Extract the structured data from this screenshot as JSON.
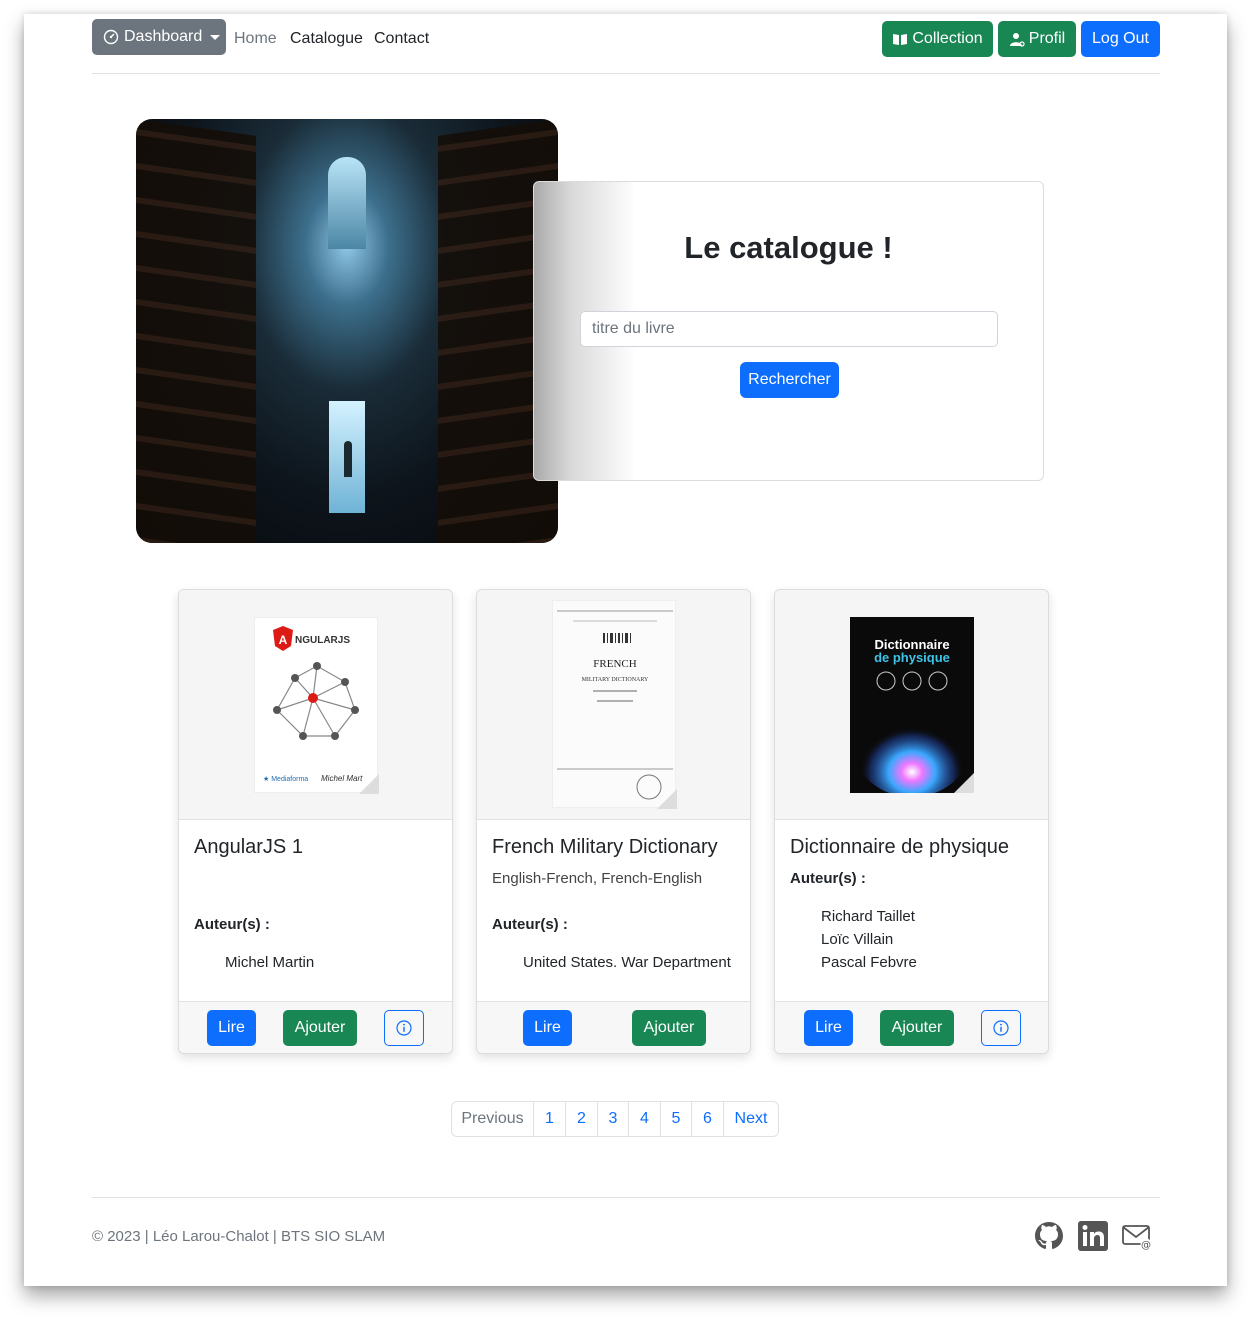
{
  "nav": {
    "dashboard_label": "Dashboard",
    "links": [
      "Home",
      "Catalogue",
      "Contact"
    ],
    "collection_label": "Collection",
    "profile_label": "Profil",
    "logout_label": "Log Out"
  },
  "hero": {
    "title": "Le catalogue !",
    "search_placeholder": "titre du livre",
    "search_button": "Rechercher"
  },
  "books": [
    {
      "title": "AngularJS 1",
      "subtitle": "",
      "authors_label": "Auteur(s) :",
      "authors": [
        "Michel Martin"
      ],
      "read_label": "Lire",
      "add_label": "Ajouter",
      "cover": {
        "brand": "NGULARJS",
        "author": "Michel Mart"
      }
    },
    {
      "title": "French Military Dictionary",
      "subtitle": "English-French, French-English",
      "authors_label": "Auteur(s) :",
      "authors": [
        "United States. War Department"
      ],
      "read_label": "Lire",
      "add_label": "Ajouter",
      "cover": {
        "heading": "FRENCH",
        "line": "MILITARY DICTIONARY"
      }
    },
    {
      "title": "Dictionnaire de physique",
      "subtitle": "",
      "authors_label": "Auteur(s) :",
      "authors": [
        "Richard Taillet",
        "Loïc Villain",
        "Pascal Febvre"
      ],
      "read_label": "Lire",
      "add_label": "Ajouter",
      "cover": {
        "line1": "Dictionnaire",
        "line2": "de physique"
      }
    }
  ],
  "pagination": {
    "previous": "Previous",
    "pages": [
      "1",
      "2",
      "3",
      "4",
      "5",
      "6"
    ],
    "next": "Next"
  },
  "footer": {
    "text": "© 2023 | Léo Larou-Chalot | BTS SIO SLAM",
    "icons": [
      "github-icon",
      "linkedin-icon",
      "email-icon"
    ]
  },
  "colors": {
    "primary": "#0d6efd",
    "success": "#198754",
    "secondary": "#6c757d"
  }
}
